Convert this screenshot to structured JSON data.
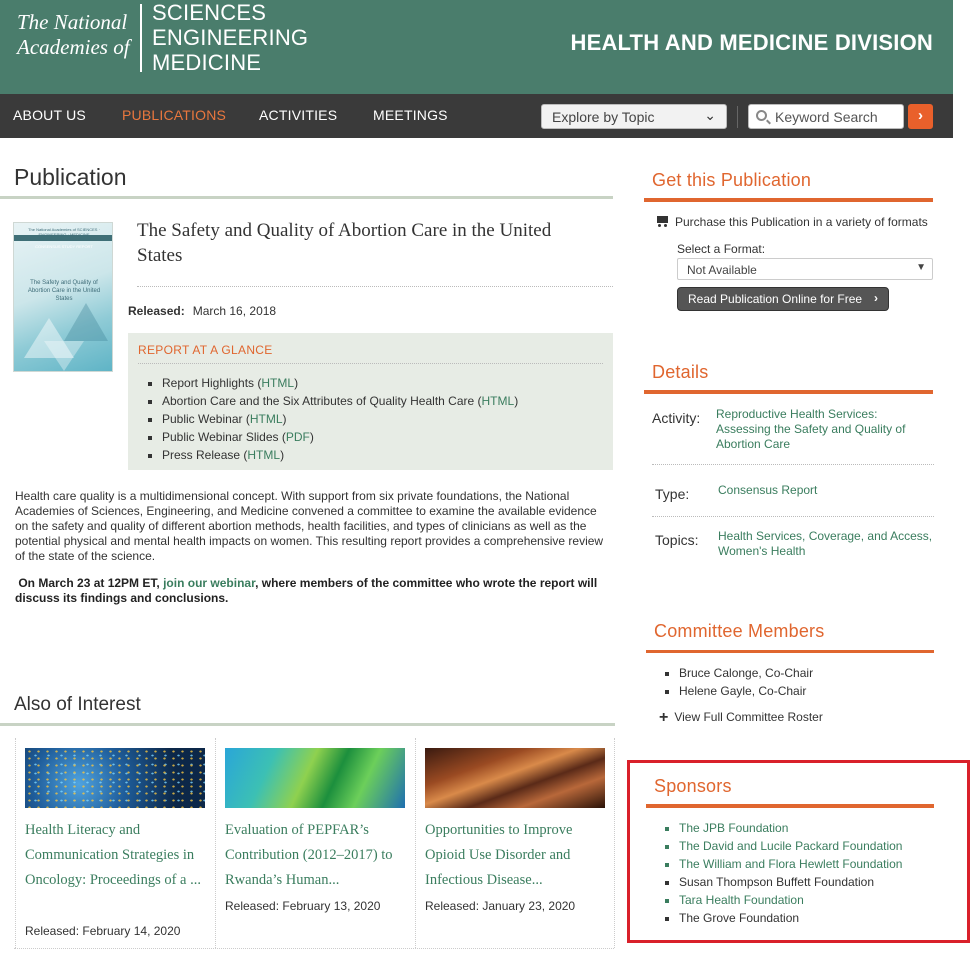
{
  "header": {
    "logo_left_lines": [
      "The National",
      "Academies of"
    ],
    "logo_right_lines": [
      "SCIENCES",
      "ENGINEERING",
      "MEDICINE"
    ],
    "division": "HEALTH AND MEDICINE DIVISION"
  },
  "nav": {
    "items": [
      "ABOUT US",
      "PUBLICATIONS",
      "ACTIVITIES",
      "MEETINGS"
    ],
    "active": "PUBLICATIONS",
    "explore_label": "Explore by Topic",
    "search_placeholder": "Keyword Search"
  },
  "publication": {
    "heading": "Publication",
    "title": "The Safety and Quality of Abortion Care in the United States",
    "cover_top": "The National Academies of SCIENCES · ENGINEERING · MEDICINE",
    "cover_label": "CONSENSUS STUDY REPORT",
    "cover_title": "The Safety and Quality of Abortion Care in the United States",
    "released_label": "Released:",
    "released_date": "March 16, 2018",
    "glance": {
      "title": "REPORT AT A GLANCE",
      "items": [
        {
          "text": "Report Highlights",
          "link": "HTML"
        },
        {
          "text": "Abortion Care and the Six Attributes of Quality Health Care",
          "link": "HTML"
        },
        {
          "text": "Public Webinar",
          "link": "HTML"
        },
        {
          "text": "Public Webinar Slides",
          "link": "PDF"
        },
        {
          "text": "Press Release",
          "link": "HTML"
        }
      ]
    },
    "summary": "Health care quality is a multidimensional concept. With support from six private foundations, the National Academies of Sciences, Engineering, and Medicine convened a committee to examine the available evidence on the safety and quality of different abortion methods, health facilities, and types of clinicians as well as the potential physical and mental health impacts on women. This resulting report provides a comprehensive review of the state of the science.",
    "webinar_pre": "On March 23 at 12PM ET,",
    "webinar_link": "join our webinar",
    "webinar_post": ", where members of the committee who wrote the report will discuss its findings and conclusions."
  },
  "also_of_interest": {
    "heading": "Also of Interest",
    "cards": [
      {
        "title": "Health Literacy and Communication Strategies in Oncology: Proceedings of a ...",
        "released": "Released: February 14, 2020"
      },
      {
        "title": "Evaluation of PEPFAR’s Contribution (2012–2017) to Rwanda’s Human...",
        "released": "Released: February 13, 2020"
      },
      {
        "title": "Opportunities to Improve Opioid Use Disorder and Infectious Disease...",
        "released": "Released: January 23, 2020"
      }
    ]
  },
  "sidebar": {
    "get": {
      "heading": "Get this Publication",
      "purchase_text": "Purchase this Publication in a variety of formats",
      "format_label": "Select a Format:",
      "format_value": "Not Available",
      "read_button": "Read Publication Online for Free"
    },
    "details": {
      "heading": "Details",
      "activity_label": "Activity:",
      "activity_value": "Reproductive Health Services: Assessing the Safety and Quality of Abortion Care",
      "type_label": "Type:",
      "type_value": "Consensus Report",
      "topics_label": "Topics:",
      "topics_value": "Health Services, Coverage, and Access, Women's Health"
    },
    "committee": {
      "heading": "Committee Members",
      "members": [
        "Bruce Calonge, Co-Chair",
        "Helene Gayle, Co-Chair"
      ],
      "roster_link": "View Full Committee Roster"
    },
    "sponsors": {
      "heading": "Sponsors",
      "items": [
        {
          "name": "The JPB Foundation",
          "link": true
        },
        {
          "name": "The David and Lucile Packard Foundation",
          "link": true
        },
        {
          "name": "The William and Flora Hewlett Foundation",
          "link": true
        },
        {
          "name": "Susan Thompson Buffett Foundation",
          "link": false
        },
        {
          "name": "Tara Health Foundation",
          "link": true
        },
        {
          "name": "The Grove Foundation",
          "link": false
        }
      ]
    }
  },
  "colors": {
    "header_green": "#4a7d6c",
    "nav_dark": "#3a3a3a",
    "accent_orange": "#e0662f",
    "link_green": "#3a7d5e",
    "highlight_red": "#d9202a"
  }
}
